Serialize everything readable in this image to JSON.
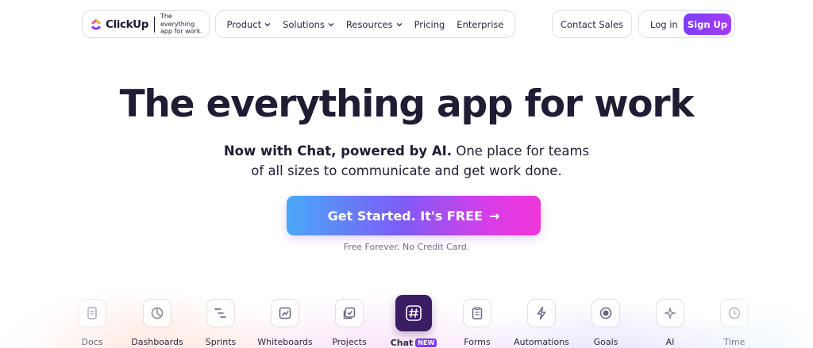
{
  "brand": {
    "name": "ClickUp",
    "tagline": "The everything app for work."
  },
  "nav": {
    "items": [
      {
        "label": "Product",
        "dropdown": true
      },
      {
        "label": "Solutions",
        "dropdown": true
      },
      {
        "label": "Resources",
        "dropdown": true
      },
      {
        "label": "Pricing",
        "dropdown": false
      },
      {
        "label": "Enterprise",
        "dropdown": false
      }
    ],
    "contact_sales": "Contact Sales",
    "login": "Log in",
    "signup": "Sign Up"
  },
  "hero": {
    "title": "The everything app for work",
    "subtitle_bold": "Now with Chat, powered by AI.",
    "subtitle_rest": " One place for teams",
    "subtitle_line2": "of all sizes to communicate and get work done.",
    "cta_label": "Get Started. It's FREE",
    "cta_arrow": "→",
    "cta_note": "Free Forever. No Credit Card."
  },
  "features": [
    {
      "label": "Docs",
      "icon": "doc-icon"
    },
    {
      "label": "Dashboards",
      "icon": "dashboard-icon"
    },
    {
      "label": "Sprints",
      "icon": "sprints-icon"
    },
    {
      "label": "Whiteboards",
      "icon": "whiteboard-icon"
    },
    {
      "label": "Projects",
      "icon": "projects-icon"
    },
    {
      "label": "Chat",
      "icon": "hash-icon",
      "badge": "NEW",
      "active": true
    },
    {
      "label": "Forms",
      "icon": "clipboard-icon"
    },
    {
      "label": "Automations",
      "icon": "bolt-icon"
    },
    {
      "label": "Goals",
      "icon": "target-icon"
    },
    {
      "label": "AI",
      "icon": "sparkle-icon"
    },
    {
      "label": "Time",
      "icon": "clock-icon"
    }
  ],
  "colors": {
    "text": "#1f1d33",
    "accent_purple": "#7b3dff",
    "active_tile": "#3a1d63"
  }
}
